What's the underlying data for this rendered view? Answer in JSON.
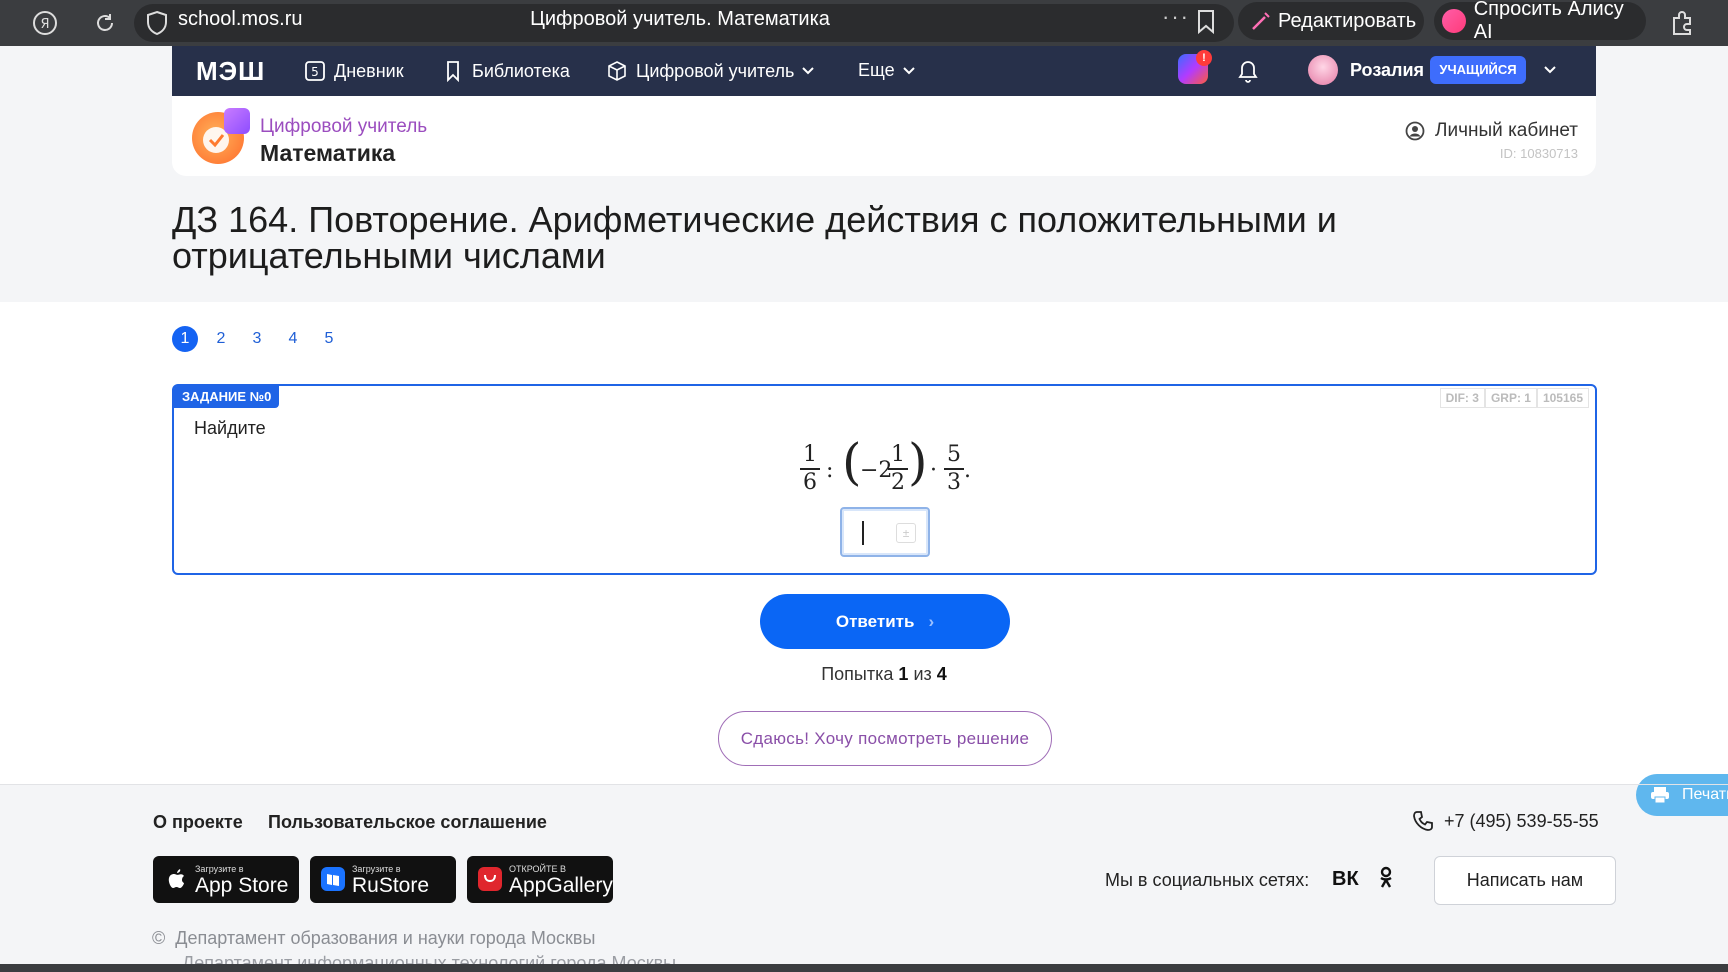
{
  "browser": {
    "url": "school.mos.ru",
    "tab_title": "Цифровой учитель. Математика",
    "dots": "···",
    "edit_label": "Редактировать",
    "alice_label": "Спросить Алису AI"
  },
  "nav": {
    "logo": "МЭШ",
    "diary": "Дневник",
    "library": "Библиотека",
    "teacher": "Цифровой учитель",
    "more": "Еще",
    "notif_badge": "!",
    "user_name": "Розалия",
    "role": "УЧАЩИЙСЯ"
  },
  "subject": {
    "subtitle": "Цифровой учитель",
    "title": "Математика",
    "cabinet": "Личный кабинет",
    "id": "ID: 10830713"
  },
  "page_title_line1": "ДЗ 164. Повторение. Арифметические действия с положительными и",
  "page_title_line2": "отрицательными числами",
  "pager": [
    "1",
    "2",
    "3",
    "4",
    "5"
  ],
  "task": {
    "label": "ЗАДАНИЕ №0",
    "meta": [
      "DIF: 3",
      "GRP: 1",
      "105165"
    ],
    "prompt": "Найдите",
    "formula": {
      "f1_num": "1",
      "f1_den": "6",
      "colon": ":",
      "lparen": "(",
      "minus_two": "−2",
      "f2_num": "1",
      "f2_den": "2",
      "rparen": ")",
      "dot": "·",
      "f3_num": "5",
      "f3_den": "3",
      "period": "."
    },
    "input_value": ""
  },
  "answer_button": "Ответить",
  "attempts": {
    "prefix": "Попытка",
    "current": "1",
    "middle": "из",
    "total": "4"
  },
  "giveup_button": "Сдаюсь! Хочу посмотреть решение",
  "print_button": "Печать",
  "footer": {
    "about": "О проекте",
    "agreement": "Пользовательское соглашение",
    "phone": "+7 (495) 539-55-55",
    "stores": [
      {
        "small": "Загрузите в",
        "big": "App Store"
      },
      {
        "small": "Загрузите в",
        "big": "RuStore"
      },
      {
        "small": "ОТКРОЙТЕ В",
        "big": "AppGallery"
      }
    ],
    "social_label": "Мы в социальных сетях:",
    "vk": "ВК",
    "write_button": "Написать нам",
    "copyright1": "Департамент образования и науки города Москвы",
    "copyright2": "Департамент информационных технологий города Москвы"
  },
  "colors": {
    "nav_bg": "#27304a",
    "accent": "#0a66f5",
    "giveup": "#8a4fa8",
    "subject": "#9b4dbf"
  }
}
